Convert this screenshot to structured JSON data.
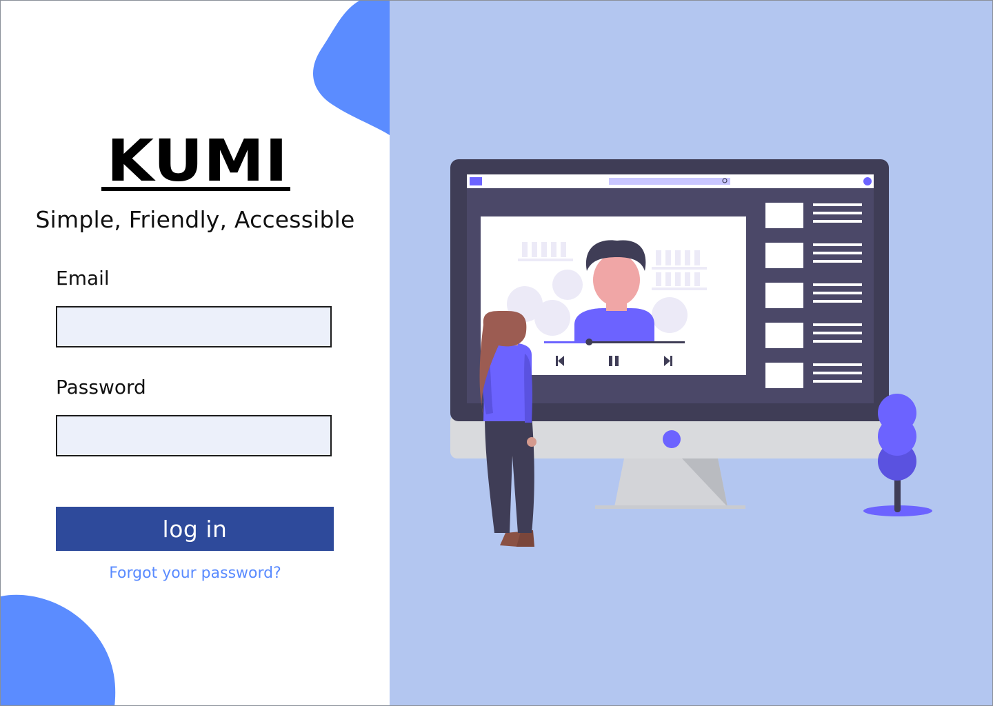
{
  "brand": {
    "logo_text": "KUMI",
    "tagline": "Simple, Friendly, Accessible"
  },
  "form": {
    "email_label": "Email",
    "email_value": "",
    "password_label": "Password",
    "password_value": "",
    "login_label": "log in",
    "forgot_label": "Forgot your password?"
  },
  "colors": {
    "accent_blob": "#5b8cff",
    "button": "#2e4a9b",
    "link": "#5a8bff",
    "input_fill": "#ecf0fa",
    "right_panel_bg": "#b3c6f0",
    "illustration_primary": "#6c63ff"
  },
  "illustration": {
    "name": "video-streaming-illustration",
    "video_controls": [
      "skip-back-icon",
      "pause-icon",
      "skip-forward-icon"
    ],
    "progress": 0.32
  }
}
